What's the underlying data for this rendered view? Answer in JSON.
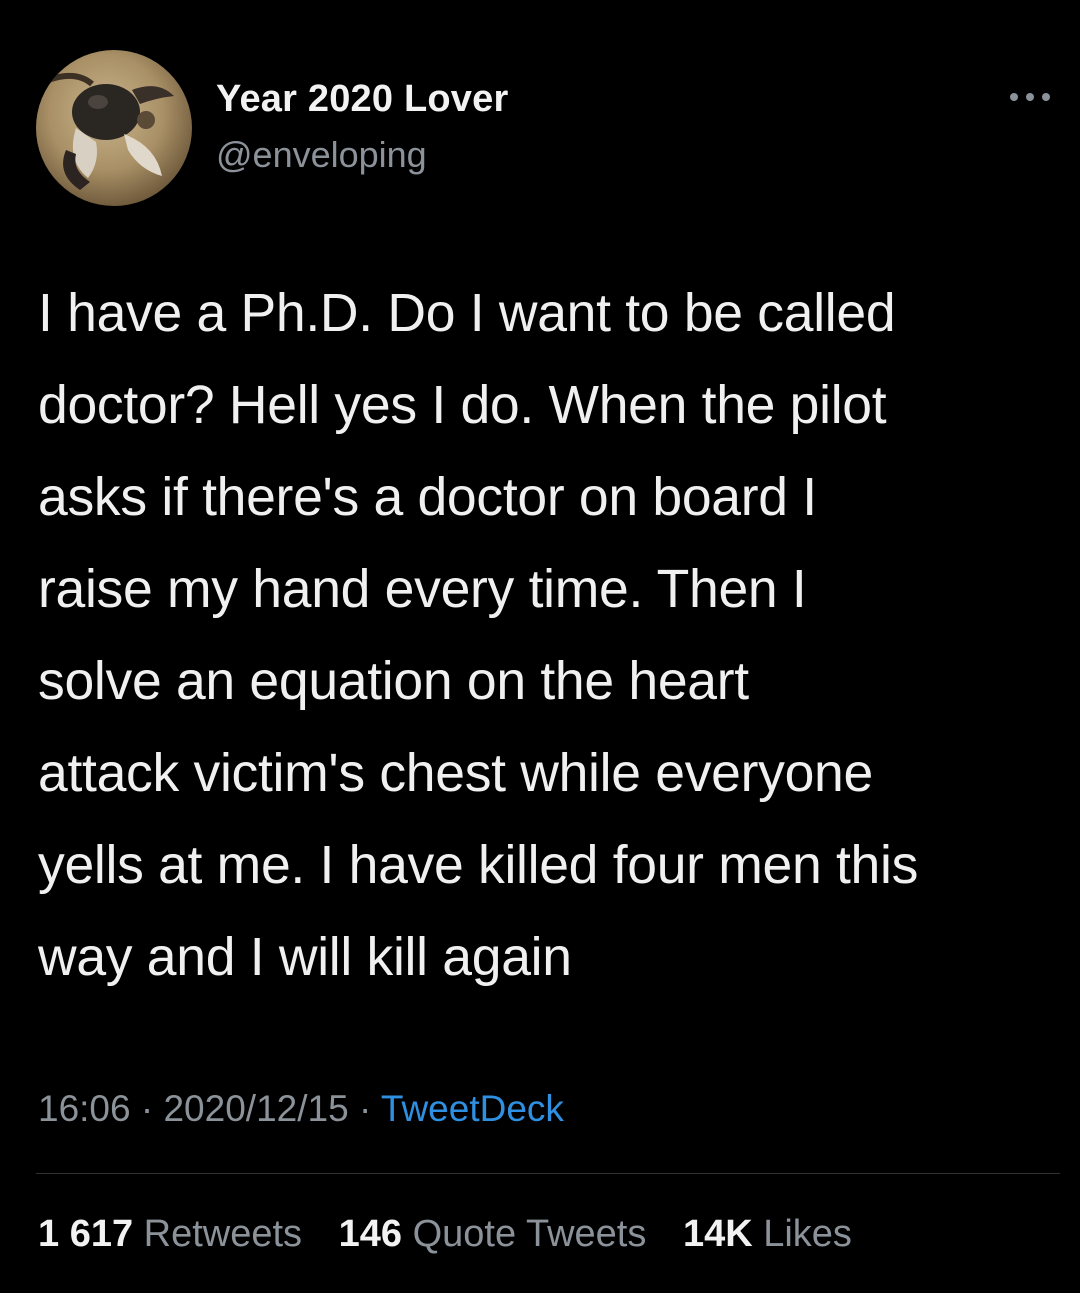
{
  "user": {
    "display_name": "Year 2020 Lover",
    "handle": "@enveloping",
    "avatar_icon": "profile-avatar-image"
  },
  "more_icon": "more-options-icon",
  "tweet": {
    "lines": [
      "I have a Ph.D. Do I want to be called",
      "doctor? Hell yes I do. When the pilot",
      "asks if there's a doctor on board I",
      "raise my hand every time. Then I",
      "solve an equation on the heart",
      "attack victim's chest while everyone",
      "yells at me. I have killed four men this",
      "way and I will kill again"
    ]
  },
  "meta": {
    "time": "16:06",
    "separator": " · ",
    "date": "2020/12/15",
    "source": "TweetDeck"
  },
  "stats": {
    "retweets_count": "1 617",
    "retweets_label": "Retweets",
    "quotes_count": "146",
    "quotes_label": "Quote Tweets",
    "likes_count": "14K",
    "likes_label": "Likes"
  },
  "colors": {
    "background": "#000000",
    "text": "#f0f0f0",
    "secondary_text": "#8b9299",
    "link": "#2f8fe0"
  }
}
